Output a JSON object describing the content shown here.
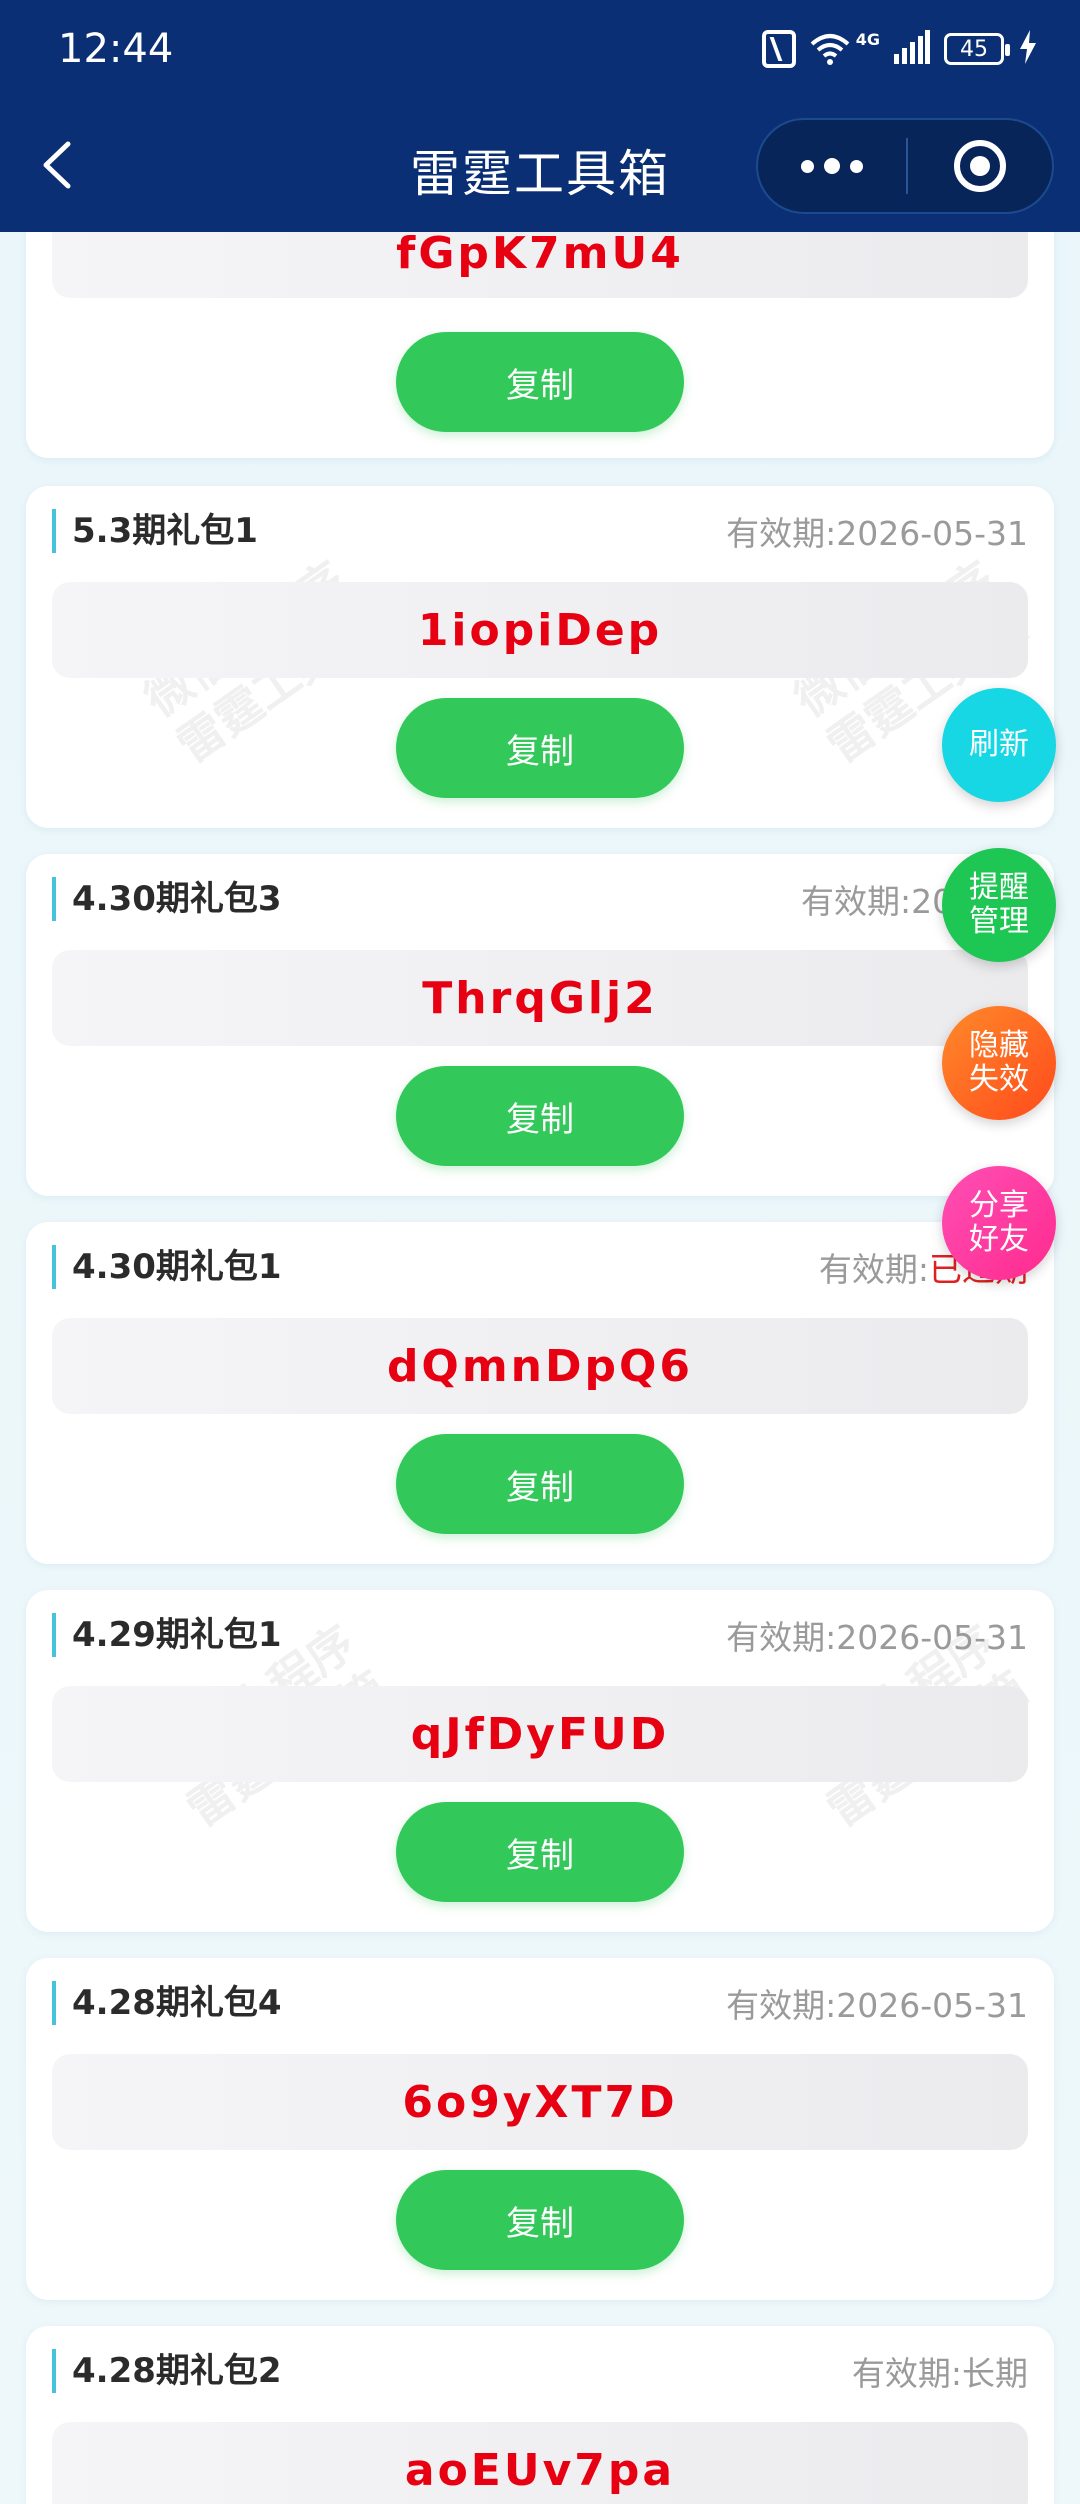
{
  "status_bar": {
    "time": "12:44",
    "network": "4G",
    "battery": "45"
  },
  "nav": {
    "title": "雷霆工具箱"
  },
  "cards": [
    {
      "title": "",
      "expiry_label": "",
      "expiry_value": "",
      "code": "fGpK7mU4",
      "copy_label": "复制"
    },
    {
      "title": "5.3期礼包1",
      "expiry_label": "有效期:",
      "expiry_value": "2026-05-31",
      "code": "1iopiDep",
      "copy_label": "复制"
    },
    {
      "title": "4.30期礼包3",
      "expiry_label": "有效期:",
      "expiry_value": "2026-0",
      "code": "ThrqGlj2",
      "copy_label": "复制"
    },
    {
      "title": "4.30期礼包1",
      "expiry_label": "有效期:",
      "expiry_value": "已过期",
      "code": "dQmnDpQ6",
      "copy_label": "复制"
    },
    {
      "title": "4.29期礼包1",
      "expiry_label": "有效期:",
      "expiry_value": "2026-05-31",
      "code": "qJfDyFUD",
      "copy_label": "复制"
    },
    {
      "title": "4.28期礼包4",
      "expiry_label": "有效期:",
      "expiry_value": "2026-05-31",
      "code": "6o9yXT7D",
      "copy_label": "复制"
    },
    {
      "title": "4.28期礼包2",
      "expiry_label": "有效期:",
      "expiry_value": "长期",
      "code": "aoEUv7pa",
      "copy_label": ""
    }
  ],
  "watermark": {
    "line1": "微信小程序",
    "line2": "雷霆工具箱"
  },
  "float_buttons": {
    "refresh": "刷新",
    "remind": "提醒管理",
    "hide": "隐藏失效",
    "share": "分享好友"
  },
  "colors": {
    "nav_bg": "#0b2f74",
    "code_red": "#e60012",
    "copy_green": "#33c95a",
    "accent_cyan": "#45c3d8"
  }
}
